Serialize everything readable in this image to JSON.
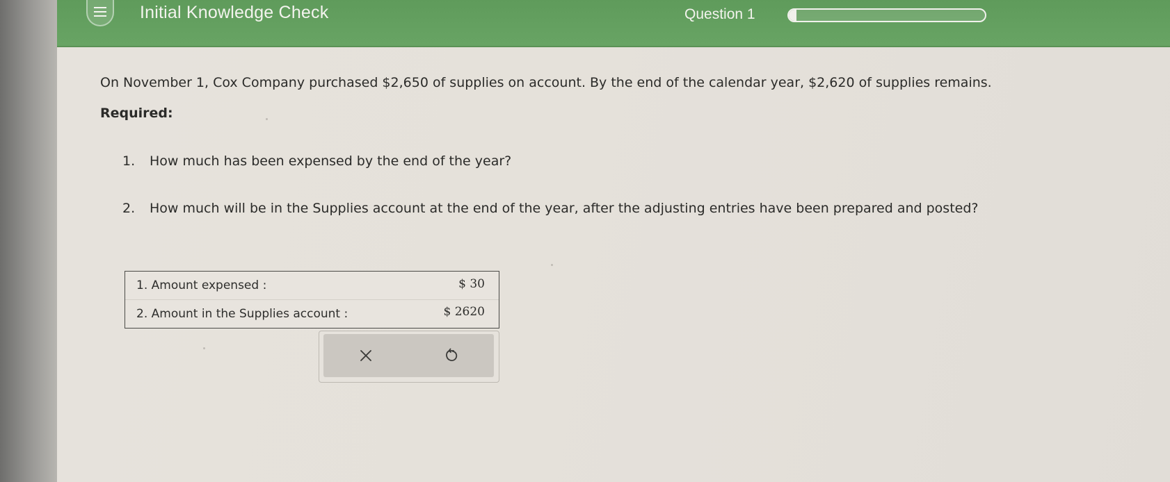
{
  "header": {
    "title": "Initial Knowledge Check",
    "question_label": "Question 1",
    "progress_fraction": 0.04,
    "menu_icon": "hamburger-menu-icon",
    "bar_color": "#65a161"
  },
  "problem": {
    "text": "On November 1, Cox Company purchased $2,650 of supplies on account. By the end of the calendar year, $2,620 of supplies remains.",
    "required_label": "Required:",
    "questions": [
      {
        "number": "1.",
        "text": "How much has been expensed by the end of the year?"
      },
      {
        "number": "2.",
        "text": "How much will be in the Supplies account at the end of the year, after the adjusting entries have been prepared and posted?"
      }
    ]
  },
  "answers": [
    {
      "label": "1. Amount expensed :",
      "value": "$ 30"
    },
    {
      "label": "2. Amount in the Supplies account :",
      "value": "$ 2620"
    }
  ],
  "actions": {
    "clear_icon": "close-x-icon",
    "reset_icon": "undo-reset-icon"
  }
}
